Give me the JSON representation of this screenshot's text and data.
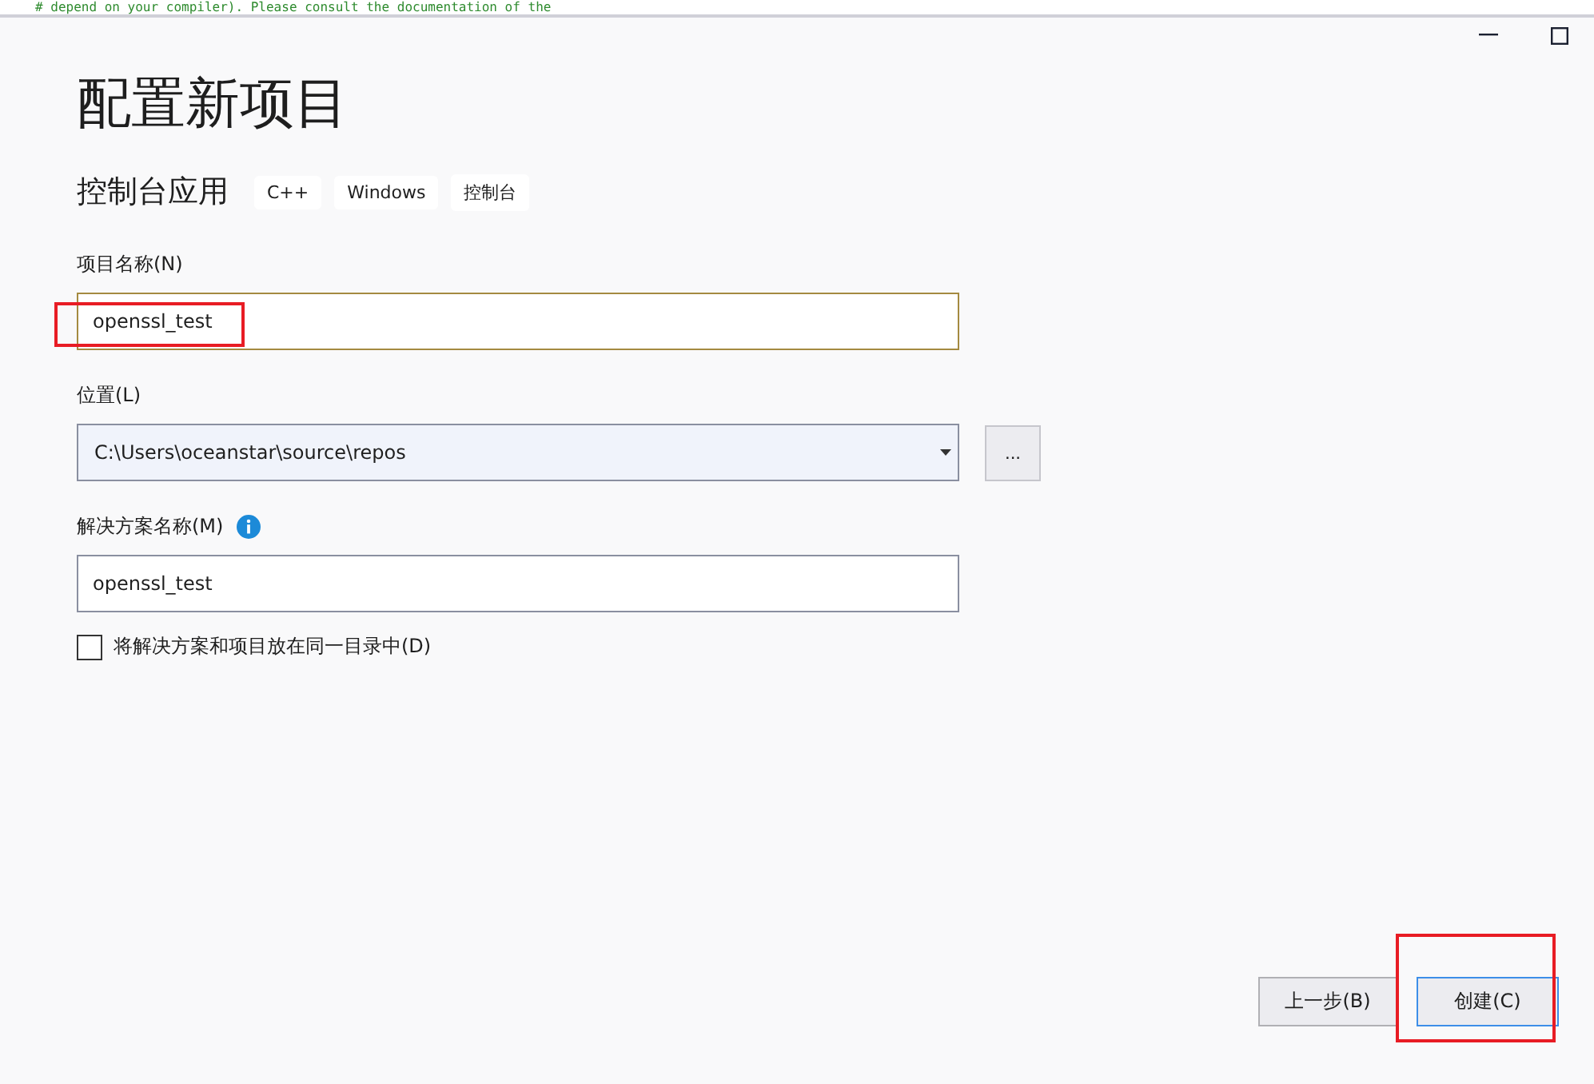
{
  "background_code_line": "# depend on your compiler). Please consult the documentation of the",
  "window": {
    "title": "配置新项目",
    "controls": [
      {
        "kind": "minimize"
      },
      {
        "kind": "maximize"
      }
    ]
  },
  "template": {
    "name": "控制台应用",
    "tags": [
      "C++",
      "Windows",
      "控制台"
    ]
  },
  "project_name": {
    "label": "项目名称(N)",
    "value": "openssl_test",
    "focused": true,
    "highlighted": true
  },
  "location": {
    "label": "位置(L)",
    "value": "C:\\Users\\oceanstar\\source\\repos",
    "browse_label": "..."
  },
  "solution_name": {
    "label": "解决方案名称(M)",
    "value": "openssl_test"
  },
  "same_directory": {
    "label": "将解决方案和项目放在同一目录中(D)",
    "checked": false
  },
  "buttons": [
    {
      "label": "上一步(B)",
      "kind": "secondary",
      "highlighted": false
    },
    {
      "label": "创建(C)",
      "kind": "primary",
      "highlighted": true
    }
  ]
}
